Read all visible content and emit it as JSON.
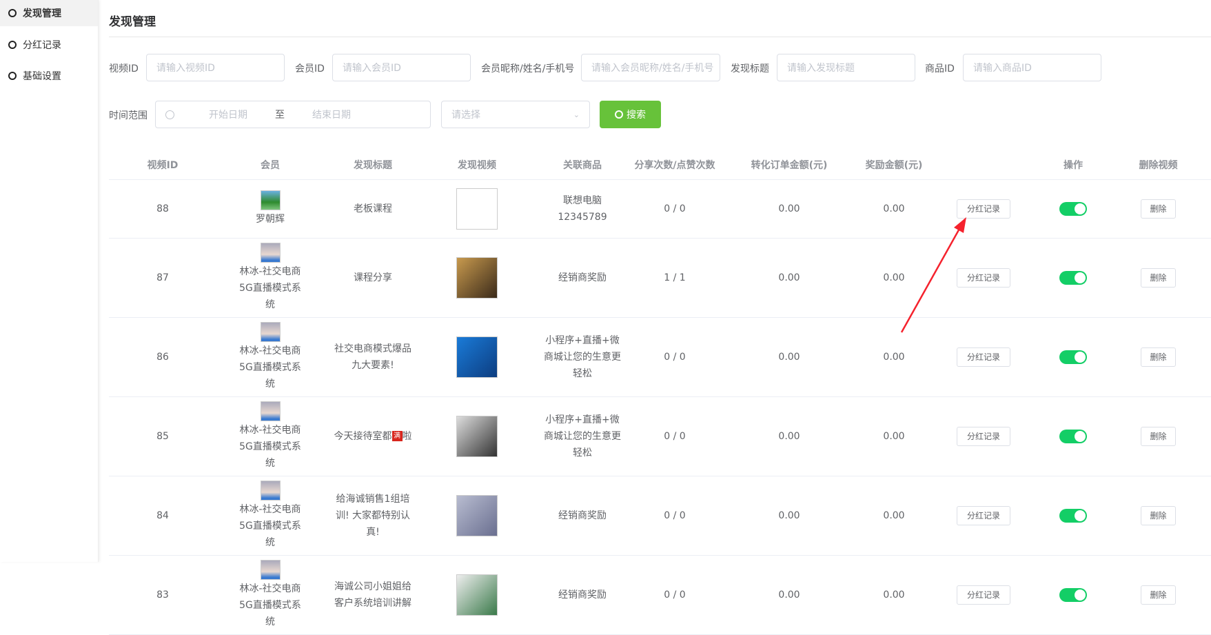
{
  "sidebar": {
    "items": [
      {
        "label": "发现管理",
        "active": true
      },
      {
        "label": "分红记录"
      },
      {
        "label": "基础设置"
      }
    ]
  },
  "page_title": "发现管理",
  "filters": {
    "video_id": {
      "label": "视频ID",
      "placeholder": "请输入视频ID"
    },
    "member_id": {
      "label": "会员ID",
      "placeholder": "请输入会员ID"
    },
    "member_name": {
      "label": "会员昵称/姓名/手机号",
      "placeholder": "请输入会员昵称/姓名/手机号"
    },
    "discover_title": {
      "label": "发现标题",
      "placeholder": "请输入发现标题"
    },
    "product_id": {
      "label": "商品ID",
      "placeholder": "请输入商品ID"
    },
    "time_range": {
      "label": "时间范围",
      "start_placeholder": "开始日期",
      "separator": "至",
      "end_placeholder": "结束日期"
    },
    "select_placeholder": "请选择",
    "search_label": "搜索"
  },
  "table": {
    "headers": [
      "视频ID",
      "会员",
      "发现标题",
      "发现视频",
      "关联商品",
      "分享次数/点赞次数",
      "转化订单金额(元)",
      "奖励金额(元)",
      "",
      "操作",
      "删除视频"
    ],
    "bonus_label": "分红记录",
    "delete_label": "删除",
    "rows": [
      {
        "id": "88",
        "member": "罗朝辉",
        "title": "老板课程",
        "product": "联想电脑12345789",
        "share_like": "0 / 0",
        "order_amount": "0.00",
        "reward": "0.00",
        "enabled": true,
        "video": "blank"
      },
      {
        "id": "87",
        "member": "林冰-社交电商5G直播模式系统",
        "title": "课程分享",
        "product": "经销商奖励",
        "share_like": "1 / 1",
        "order_amount": "0.00",
        "reward": "0.00",
        "enabled": true
      },
      {
        "id": "86",
        "member": "林冰-社交电商5G直播模式系统",
        "title": "社交电商模式爆品九大要素!",
        "product": "小程序+直播+微商城让您的生意更轻松",
        "share_like": "0 / 0",
        "order_amount": "0.00",
        "reward": "0.00",
        "enabled": true
      },
      {
        "id": "85",
        "member": "林冰-社交电商5G直播模式系统",
        "title": "今天接待室都",
        "title_emoji": "满",
        "title_suffix": "啦",
        "product": "小程序+直播+微商城让您的生意更轻松",
        "share_like": "0 / 0",
        "order_amount": "0.00",
        "reward": "0.00",
        "enabled": true
      },
      {
        "id": "84",
        "member": "林冰-社交电商5G直播模式系统",
        "title": "给海诚销售1组培训! 大家都特别认真!",
        "product": "经销商奖励",
        "share_like": "0 / 0",
        "order_amount": "0.00",
        "reward": "0.00",
        "enabled": true
      },
      {
        "id": "83",
        "member": "林冰-社交电商5G直播模式系统",
        "title": "海诚公司小姐姐给客户系统培训讲解",
        "product": "经销商奖励",
        "share_like": "0 / 0",
        "order_amount": "0.00",
        "reward": "0.00",
        "enabled": true
      }
    ]
  },
  "colors": {
    "accent": "#67c23a",
    "switch": "#13ce66",
    "arrow": "#f5222d"
  }
}
